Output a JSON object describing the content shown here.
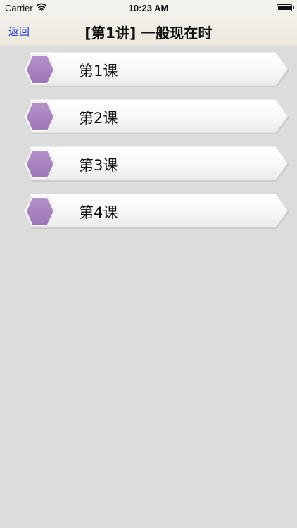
{
  "status": {
    "carrier": "Carrier",
    "time": "10:23 AM",
    "wifi_icon": "wifi-icon",
    "battery_icon": "battery-icon"
  },
  "nav": {
    "back_label": "返回",
    "title": "[第1讲] 一般现在时"
  },
  "lessons": [
    {
      "label": "第1课"
    },
    {
      "label": "第2课"
    },
    {
      "label": "第3课"
    },
    {
      "label": "第4课"
    }
  ],
  "colors": {
    "background": "#dbdcdb",
    "nav_background": "#ece8de",
    "back_link": "#2439d4",
    "hexagon": "#a985c0",
    "card": "#fbfbfb"
  }
}
